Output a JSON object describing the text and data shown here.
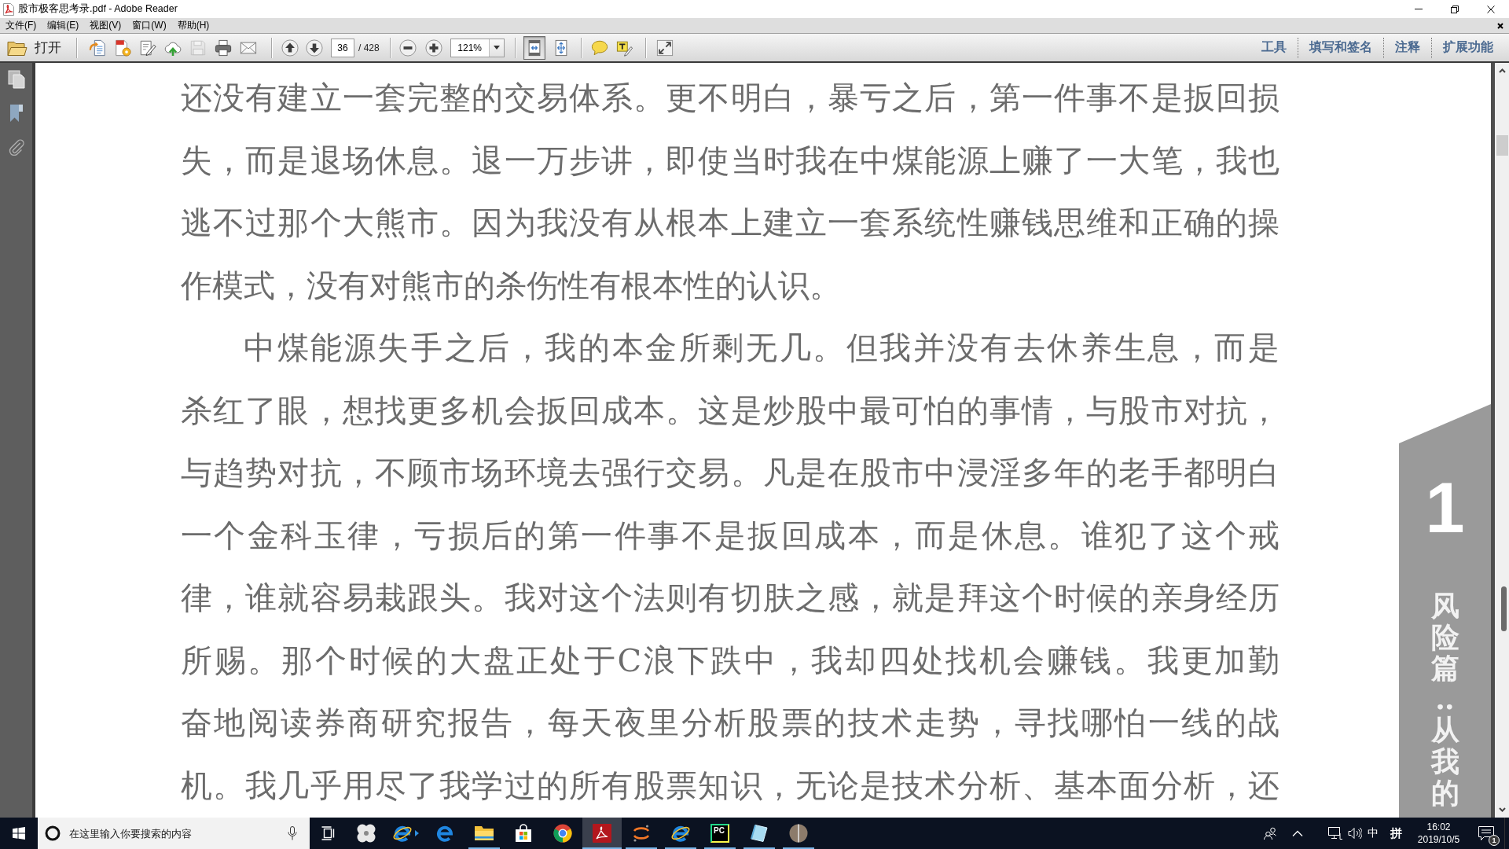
{
  "window": {
    "title": "股市极客思考录.pdf - Adobe Reader"
  },
  "menu": [
    {
      "label": "文件(F)"
    },
    {
      "label": "编辑(E)"
    },
    {
      "label": "视图(V)"
    },
    {
      "label": "窗口(W)"
    },
    {
      "label": "帮助(H)"
    }
  ],
  "toolbar": {
    "open_label": "打开",
    "save_disabled": true,
    "page_field": {
      "value": "36"
    },
    "page_total": "/ 428",
    "zoom_field": {
      "value": "121%"
    },
    "view_modes": [
      {
        "selected": true
      },
      {
        "selected": false
      }
    ],
    "panes": [
      {
        "label": "工具"
      },
      {
        "label": "填写和签名"
      },
      {
        "label": "注释"
      },
      {
        "label": "扩展功能"
      }
    ]
  },
  "document": {
    "paragraphs": [
      {
        "indented": false,
        "complete": true,
        "lines": [
          "还没有建立一套完整的交易体系。更不明白，暴亏之后，第一件事不是扳回损",
          "失，而是退场休息。退一万步讲，即使当时我在中煤能源上赚了一大笔，我也",
          "逃不过那个大熊市。因为我没有从根本上建立一套系统性赚钱思维和正确的操",
          "作模式，没有对熊市的杀伤性有根本性的认识。"
        ]
      },
      {
        "indented": true,
        "complete": false,
        "lines": [
          "中煤能源失手之后，我的本金所剩无几。但我并没有去休养生息，而是",
          "杀红了眼，想找更多机会扳回成本。这是炒股中最可怕的事情，与股市对抗，",
          "与趋势对抗，不顾市场环境去强行交易。凡是在股市中浸淫多年的老手都明白",
          "一个金科玉律，亏损后的第一件事不是扳回成本，而是休息。谁犯了这个戒",
          "律，谁就容易栽跟头。我对这个法则有切肤之感，就是拜这个时候的亲身经历",
          "所赐。那个时候的大盘正处于C浪下跌中，我却四处找机会赚钱。我更加勤",
          "奋地阅读券商研究报告，每天夜里分析股票的技术走势，寻找哪怕一线的战",
          "机。我几乎用尽了我学过的所有股票知识，无论是技术分析、基本面分析，还"
        ]
      }
    ],
    "chapter_tab": {
      "number": "1",
      "title": "风险篇‥从我的"
    }
  },
  "taskbar": {
    "search": {
      "placeholder": "在这里输入你要搜索的内容"
    },
    "apps": [
      {
        "running": false,
        "selected": false
      },
      {
        "running": false,
        "selected": false
      },
      {
        "running": false,
        "selected": false
      },
      {
        "running": true,
        "selected": false
      },
      {
        "running": false,
        "selected": false
      },
      {
        "running": false,
        "selected": false
      },
      {
        "running": true,
        "selected": true
      },
      {
        "running": true,
        "selected": false
      },
      {
        "running": true,
        "selected": false
      },
      {
        "running": true,
        "selected": false,
        "logo_text": "PC"
      },
      {
        "running": true,
        "selected": false
      },
      {
        "running": true,
        "selected": false
      }
    ],
    "ime_mode": "中",
    "ime_name": "拼",
    "clock": {
      "time": "16:02",
      "date": "2019/10/5"
    },
    "notification_count": "1"
  }
}
